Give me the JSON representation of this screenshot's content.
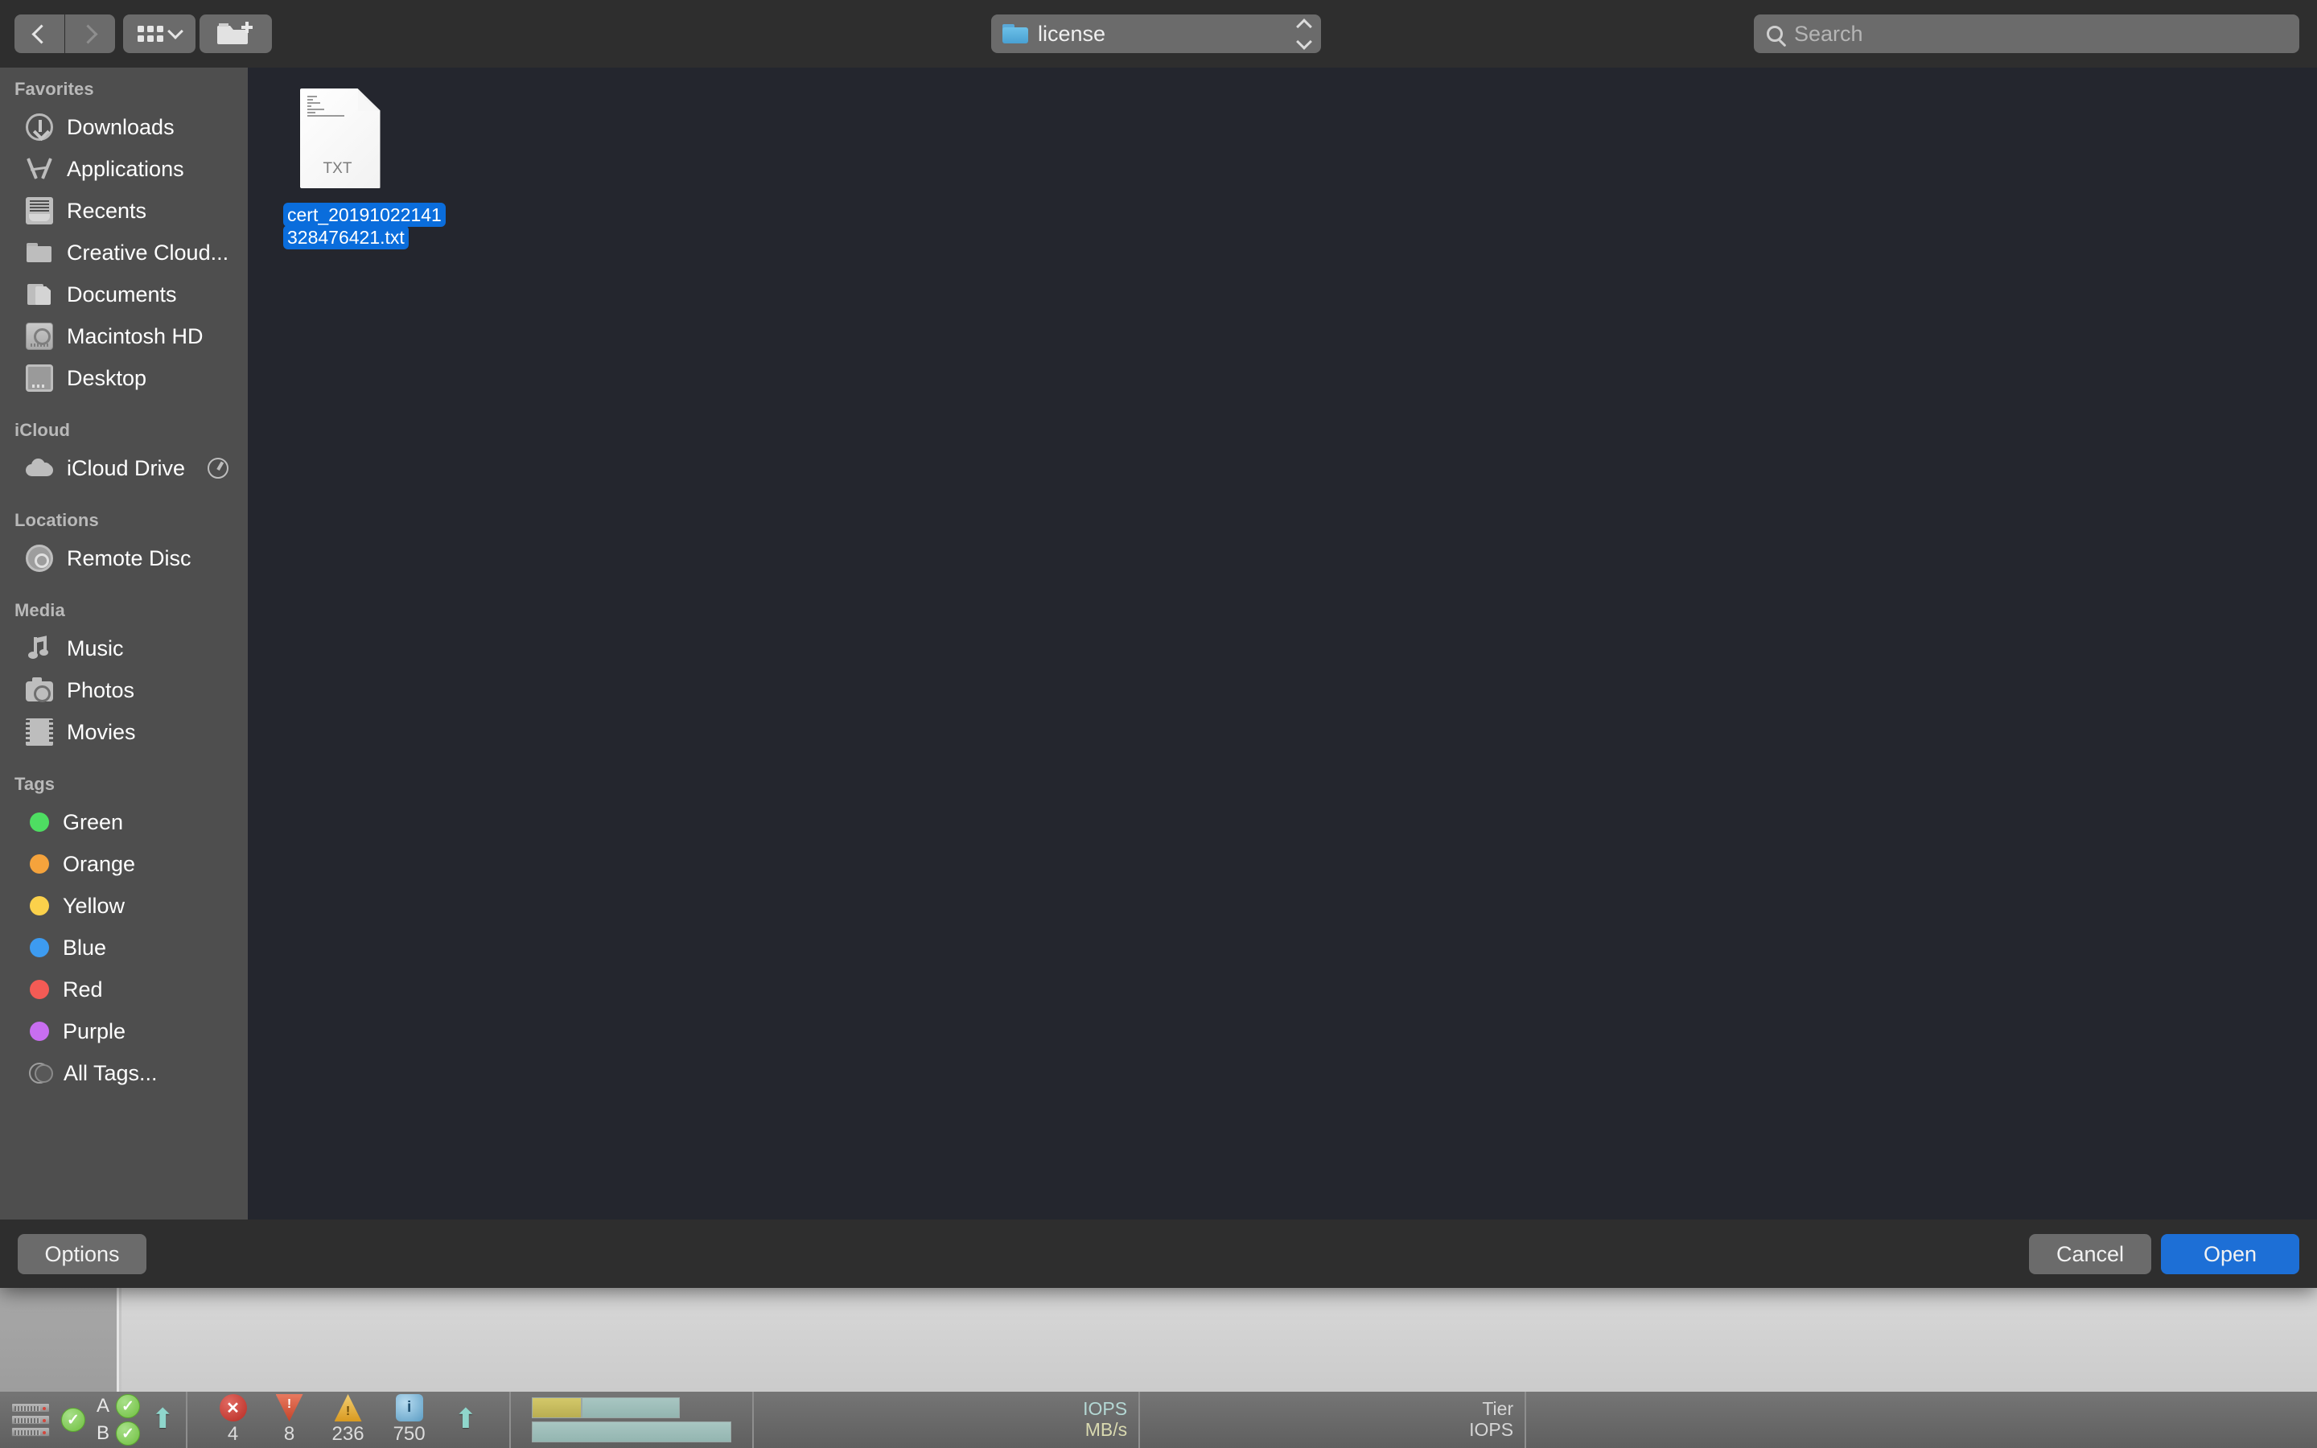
{
  "toolbar": {
    "back_icon": "chevron-left-icon",
    "forward_icon": "chevron-right-icon",
    "view_icon": "grid-view-icon",
    "view_chevron_icon": "chevron-down-icon",
    "new_folder_icon": "new-folder-icon",
    "path_label": "license",
    "path_folder_icon": "blue-folder-icon",
    "stepper_icon": "up-down-stepper-icon",
    "search_icon": "search-icon",
    "search_placeholder": "Search",
    "search_value": ""
  },
  "sidebar": {
    "sections": [
      {
        "title": "Favorites",
        "items": [
          {
            "label": "Downloads",
            "icon": "downloads-icon"
          },
          {
            "label": "Applications",
            "icon": "applications-icon"
          },
          {
            "label": "Recents",
            "icon": "recents-icon"
          },
          {
            "label": "Creative Cloud...",
            "icon": "folder-icon"
          },
          {
            "label": "Documents",
            "icon": "documents-icon"
          },
          {
            "label": "Macintosh HD",
            "icon": "hard-drive-icon"
          },
          {
            "label": "Desktop",
            "icon": "desktop-icon"
          }
        ]
      },
      {
        "title": "iCloud",
        "items": [
          {
            "label": "iCloud Drive",
            "icon": "cloud-icon",
            "accessory": "sync-progress-icon"
          }
        ]
      },
      {
        "title": "Locations",
        "items": [
          {
            "label": "Remote Disc",
            "icon": "optical-disc-icon"
          }
        ]
      },
      {
        "title": "Media",
        "items": [
          {
            "label": "Music",
            "icon": "music-note-icon"
          },
          {
            "label": "Photos",
            "icon": "camera-icon"
          },
          {
            "label": "Movies",
            "icon": "film-strip-icon"
          }
        ]
      },
      {
        "title": "Tags",
        "items": [
          {
            "label": "Green",
            "icon": "tag-dot-icon",
            "color": "#4edd62"
          },
          {
            "label": "Orange",
            "icon": "tag-dot-icon",
            "color": "#f5a33c"
          },
          {
            "label": "Yellow",
            "icon": "tag-dot-icon",
            "color": "#fbd košt"
          },
          {
            "label": "Blue",
            "icon": "tag-dot-icon",
            "color": "#3d9bf0"
          },
          {
            "label": "Red",
            "icon": "tag-dot-icon",
            "color": "#f35b55"
          },
          {
            "label": "Purple",
            "icon": "tag-dot-icon",
            "color": "#c86ef0"
          },
          {
            "label": "All Tags...",
            "icon": "all-tags-icon",
            "color": ""
          }
        ]
      }
    ]
  },
  "content": {
    "file": {
      "name": "cert_20191022141328476421.txt",
      "name_line1": "cert_20191022141",
      "name_line2": "328476421.txt",
      "kind_label": "TXT",
      "icon": "txt-document-icon",
      "selected": true,
      "selection_color": "#0a6ddc"
    }
  },
  "dialog_buttons": {
    "options": "Options",
    "cancel": "Cancel",
    "open": "Open",
    "open_accent": "#1d6fd6"
  },
  "background_app": {
    "status_bar": {
      "servers_icon": "server-stack-icon",
      "servers_status_icon": "green-check-icon",
      "controller_a_label": "A",
      "controller_a_status_icon": "green-check-icon",
      "controller_b_label": "B",
      "controller_b_status_icon": "green-check-icon",
      "uplink_icon": "up-arrow-icon",
      "alerts": [
        {
          "icon": "error-icon",
          "count": "4"
        },
        {
          "icon": "critical-icon",
          "count": "8"
        },
        {
          "icon": "warning-icon",
          "count": "236"
        },
        {
          "icon": "info-icon",
          "count": "750"
        }
      ],
      "capacity_icon": "capacity-bars-icon",
      "metric_labels": [
        "IOPS",
        "MB/s"
      ],
      "tier_labels": [
        "Tier",
        "IOPS"
      ]
    }
  }
}
